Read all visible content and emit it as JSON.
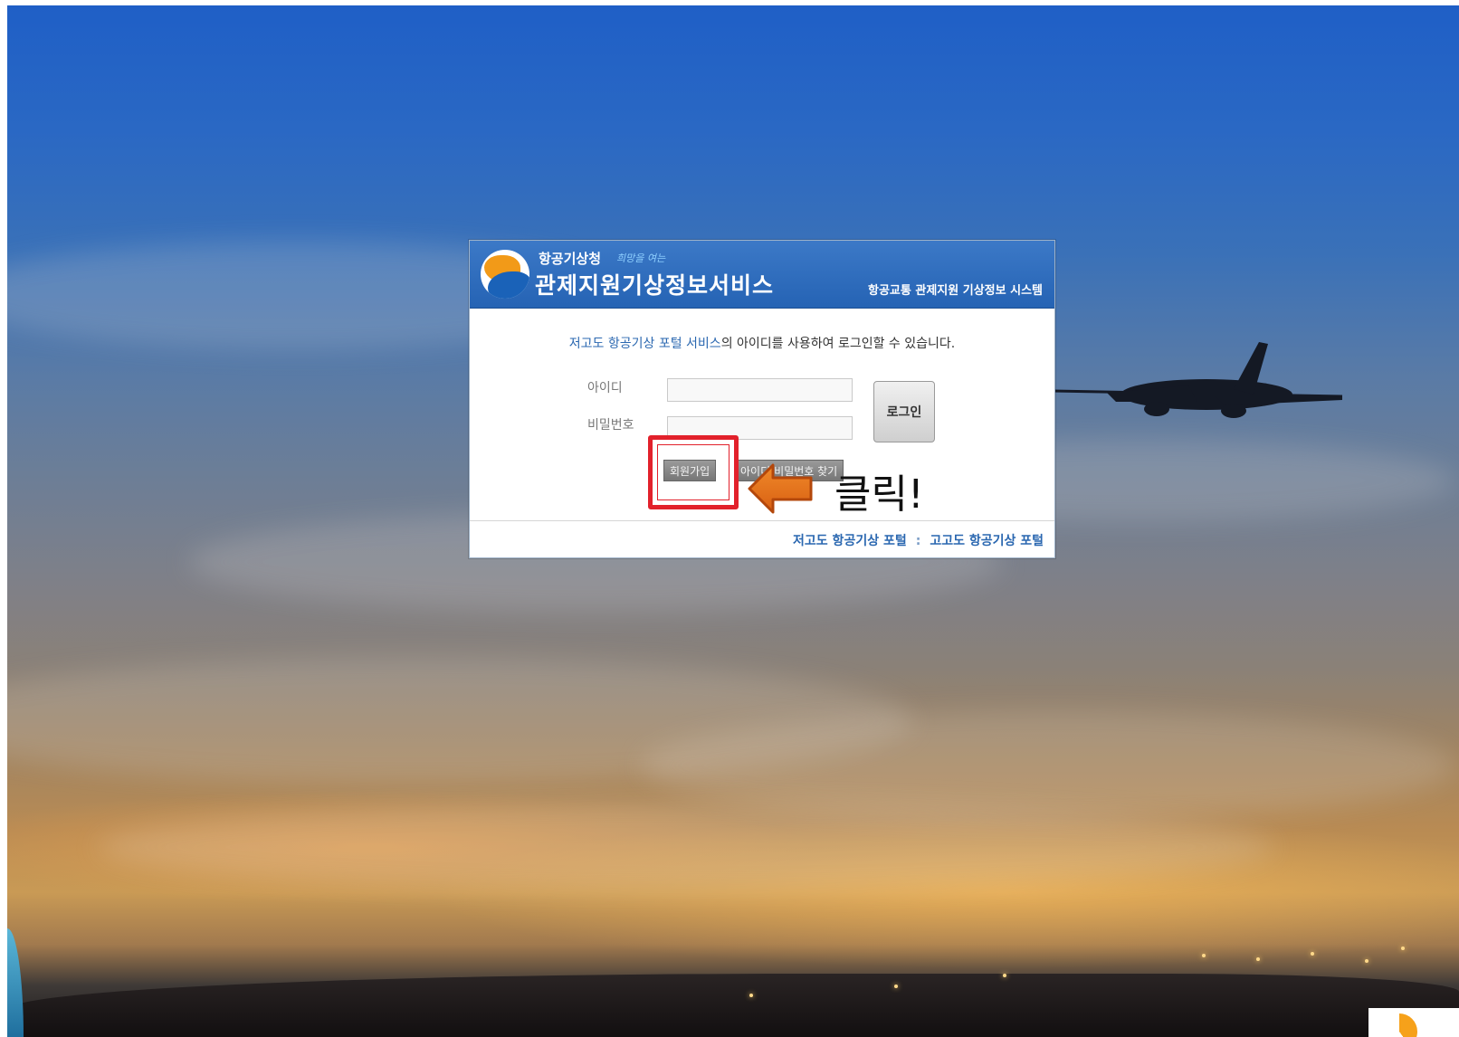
{
  "header": {
    "org_name": "항공기상청",
    "org_slogan": "희망을 여는",
    "service_title": "관제지원기상정보서비스",
    "subtitle": "항공교통 관제지원 기상정보 시스템"
  },
  "intro": {
    "link_text": "저고도 항공기상 포털 서비스",
    "rest_text": "의 아이디를 사용하여 로그인할 수 있습니다."
  },
  "form": {
    "id_label": "아이디",
    "id_value": "",
    "password_label": "비밀번호",
    "password_value": "",
    "login_label": "로그인",
    "signup_label": "회원가입",
    "find_label": "아이디/비밀번호 찾기"
  },
  "footer": {
    "low_altitude_link": "저고도 항공기상 포털",
    "separator": ":",
    "high_altitude_link": "고고도 항공기상 포털"
  },
  "annotation": {
    "click_text": "클릭!",
    "highlight_color": "#e2212b",
    "arrow_color": "#e7731c"
  },
  "icons": {
    "logo": "kma-logo-icon",
    "arrow": "left-arrow-icon",
    "plane": "airplane-icon"
  }
}
